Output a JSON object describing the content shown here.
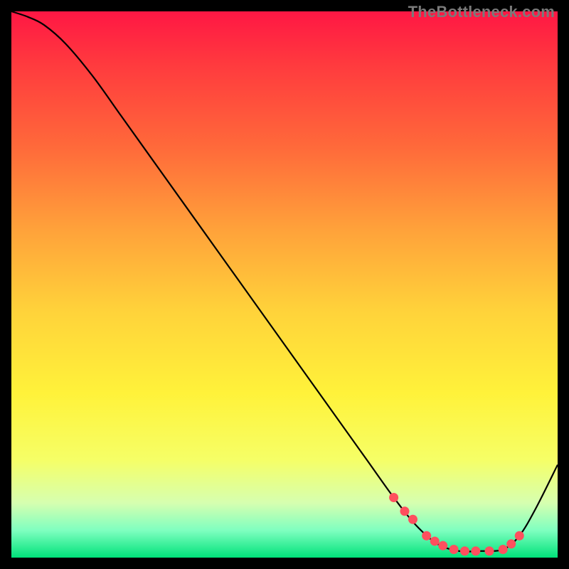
{
  "attribution": "TheBottleneck.com",
  "chart_data": {
    "type": "line",
    "title": "",
    "xlabel": "",
    "ylabel": "",
    "xlim": [
      0,
      100
    ],
    "ylim": [
      0,
      100
    ],
    "background_gradient": {
      "stops": [
        {
          "pos": 0.0,
          "color": "#ff1744"
        },
        {
          "pos": 0.1,
          "color": "#ff3b3e"
        },
        {
          "pos": 0.25,
          "color": "#ff6a3a"
        },
        {
          "pos": 0.4,
          "color": "#ffa23a"
        },
        {
          "pos": 0.55,
          "color": "#ffd33a"
        },
        {
          "pos": 0.7,
          "color": "#fff23a"
        },
        {
          "pos": 0.82,
          "color": "#f6ff66"
        },
        {
          "pos": 0.9,
          "color": "#d6ffb0"
        },
        {
          "pos": 0.95,
          "color": "#7fffc0"
        },
        {
          "pos": 1.0,
          "color": "#00e27a"
        }
      ]
    },
    "series": [
      {
        "name": "bottleneck-curve",
        "color": "#000000",
        "x": [
          0,
          3,
          6,
          10,
          15,
          20,
          25,
          30,
          35,
          40,
          45,
          50,
          55,
          60,
          65,
          70,
          74,
          78,
          82,
          86,
          90,
          93,
          96,
          100
        ],
        "y": [
          100,
          99,
          97.5,
          94,
          88,
          81,
          74,
          67,
          60,
          53,
          46,
          39,
          32,
          25,
          18,
          11,
          6,
          2.5,
          1.2,
          1.2,
          1.5,
          4,
          9,
          17
        ]
      }
    ],
    "markers": {
      "name": "highlight-dots",
      "color": "#ff4f5e",
      "x": [
        70,
        72,
        73.5,
        76,
        77.5,
        79,
        81,
        83,
        85,
        87.5,
        90,
        91.5,
        93
      ],
      "y": [
        11,
        8.5,
        7,
        4,
        3,
        2.2,
        1.5,
        1.2,
        1.2,
        1.2,
        1.5,
        2.5,
        4
      ]
    }
  }
}
